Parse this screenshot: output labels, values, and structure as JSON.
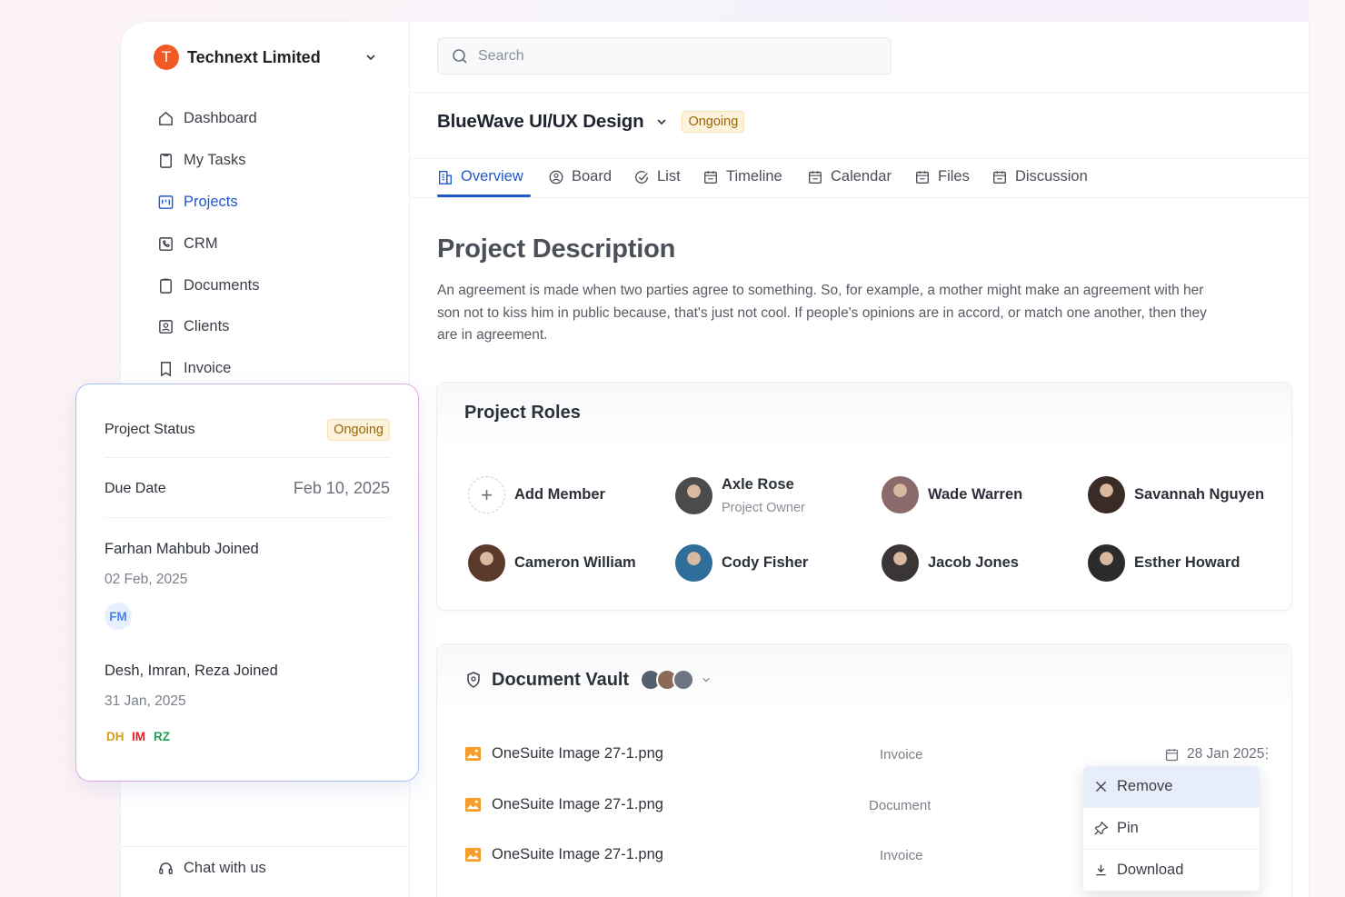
{
  "org": {
    "initial": "T",
    "name": "Technext Limited"
  },
  "nav": [
    {
      "label": "Dashboard"
    },
    {
      "label": "My Tasks"
    },
    {
      "label": "Projects"
    },
    {
      "label": "CRM"
    },
    {
      "label": "Documents"
    },
    {
      "label": "Clients"
    },
    {
      "label": "Invoice"
    }
  ],
  "chat_label": "Chat with us",
  "search": {
    "placeholder": "Search"
  },
  "project": {
    "title": "BlueWave UI/UX Design",
    "status": "Ongoing"
  },
  "tabs": [
    "Overview",
    "Board",
    "List",
    "Timeline",
    "Calendar",
    "Files",
    "Discussion"
  ],
  "description": {
    "title": "Project Description",
    "text": "An agreement is made when two parties agree to something. So, for example, a mother might make an agreement with her son not to kiss him in public because, that's just not cool. If people's opinions are in accord, or match one another, then they are in agreement."
  },
  "roles": {
    "title": "Project Roles",
    "add_label": "Add Member",
    "members": [
      {
        "name": "Axle Rose",
        "role": "Project Owner",
        "color": "#4b4b4b"
      },
      {
        "name": "Wade Warren",
        "color": "#8a6a6a"
      },
      {
        "name": "Savannah Nguyen",
        "color": "#3a2b26"
      },
      {
        "name": "Cameron William",
        "color": "#5b3a2c"
      },
      {
        "name": "Cody Fisher",
        "color": "#2f6d9a"
      },
      {
        "name": "Jacob Jones",
        "color": "#3a3636"
      },
      {
        "name": "Esther Howard",
        "color": "#2b2b2b"
      }
    ]
  },
  "vault": {
    "title": "Document Vault",
    "files": [
      {
        "name": "OneSuite Image 27-1.png",
        "type": "Invoice"
      },
      {
        "name": "OneSuite Image 27-1.png",
        "type": "Document"
      },
      {
        "name": "OneSuite Image 27-1.png",
        "type": "Invoice"
      }
    ],
    "date": "28 Jan 2025",
    "menu": [
      "Remove",
      "Pin",
      "Download"
    ]
  },
  "panel": {
    "status_label": "Project Status",
    "status": "Ongoing",
    "due_label": "Due Date",
    "due_date": "Feb 10, 2025",
    "events": [
      {
        "title": "Farhan Mahbub Joined",
        "date": "02 Feb, 2025",
        "initials": [
          "FM"
        ]
      },
      {
        "title": "Desh, Imran, Reza Joined",
        "date": "31 Jan, 2025",
        "initials": [
          "DH",
          "IM",
          "RZ"
        ]
      }
    ]
  }
}
